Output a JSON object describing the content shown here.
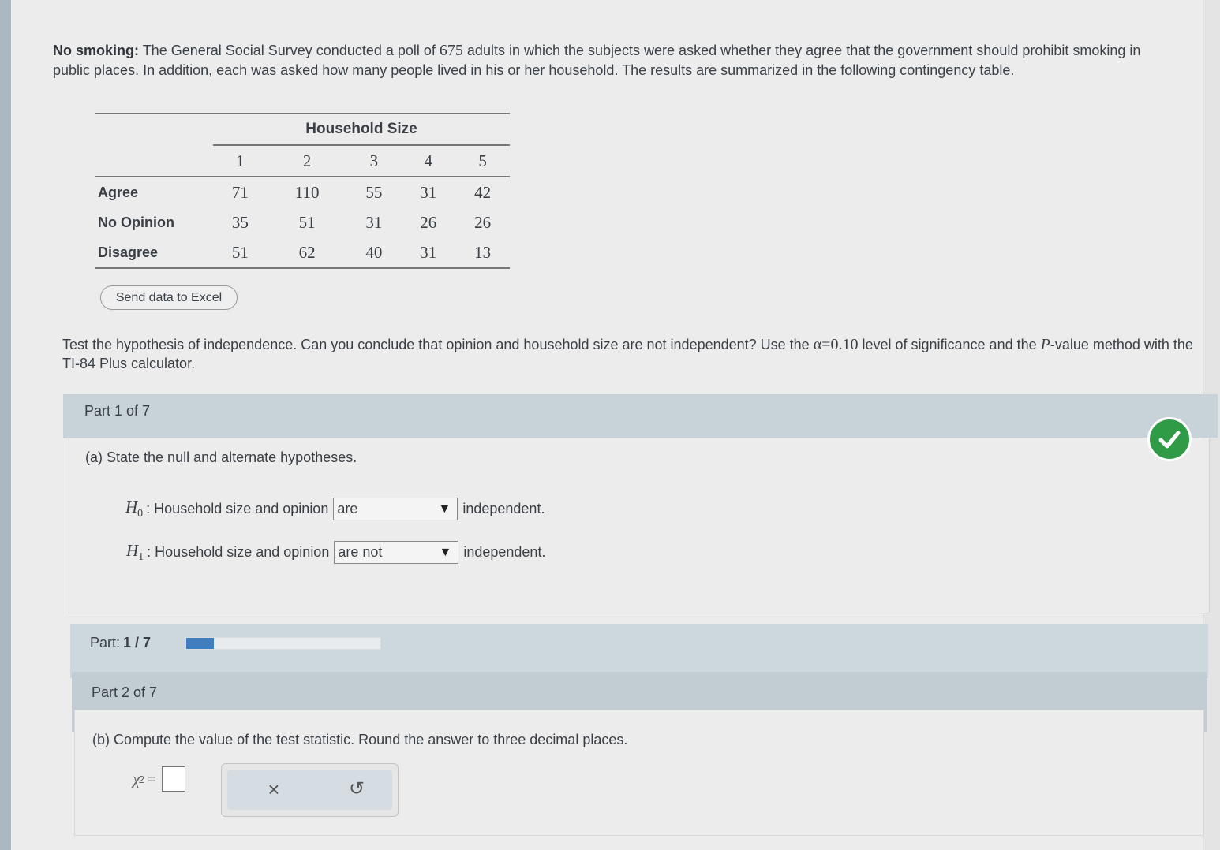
{
  "intro": {
    "lead": "No smoking:",
    "text_before_num": " The General Social Survey conducted a poll of ",
    "poll_size": "675",
    "text_after_num": " adults in which the subjects were asked whether they agree that the government should prohibit smoking in public places. In addition, each was asked how many people lived in his or her household. The results are summarized in the following contingency table."
  },
  "table": {
    "group_header": "Household Size",
    "columns": [
      "1",
      "2",
      "3",
      "4",
      "5"
    ],
    "rows": [
      {
        "label": "Agree",
        "values": [
          "71",
          "110",
          "55",
          "31",
          "42"
        ]
      },
      {
        "label": "No Opinion",
        "values": [
          "35",
          "51",
          "31",
          "26",
          "26"
        ]
      },
      {
        "label": "Disagree",
        "values": [
          "51",
          "62",
          "40",
          "31",
          "13"
        ]
      }
    ]
  },
  "excel_button": "Send data to Excel",
  "question": {
    "before_alpha": "Test the hypothesis of independence. Can you conclude that opinion and household size are not independent? Use the ",
    "alpha": "α=0.10",
    "middle": " level of significance and the ",
    "p": "P",
    "after": "-value method with the TI-84 Plus calculator."
  },
  "part1": {
    "header": "Part 1 of 7",
    "prompt": "(a) State the null and alternate hypotheses.",
    "h0": {
      "symbol": "H",
      "sub": "0",
      "text": ": Household size and opinion",
      "selected": "are",
      "suffix": "independent."
    },
    "h1": {
      "symbol": "H",
      "sub": "1",
      "text": ": Household size and opinion",
      "selected": "are not",
      "suffix": "independent."
    }
  },
  "progress": {
    "label": "Part:",
    "value": "1 / 7",
    "fraction": 0.143
  },
  "part2": {
    "header": "Part 2 of 7",
    "prompt": "(b) Compute the value of the test statistic. Round the answer to three decimal places.",
    "chi_symbol": "χ",
    "chi_sup": "2",
    "equals": "="
  },
  "icons": {
    "check": "check-circle-icon",
    "clear": "×",
    "undo": "↺",
    "dropdown": "▼"
  },
  "colors": {
    "accent": "#3f7fc1",
    "success": "#2f9b47"
  }
}
